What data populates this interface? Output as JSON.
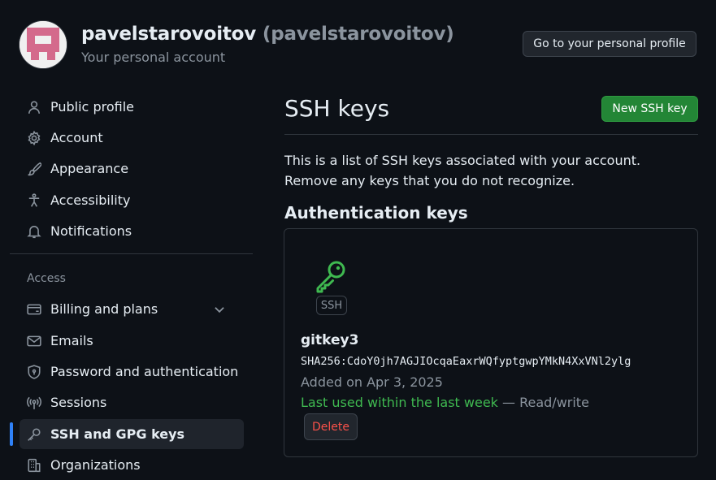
{
  "header": {
    "username": "pavelstarovoitov",
    "handle": "(pavelstarovoitov)",
    "subtitle": "Your personal account",
    "profile_button": "Go to your personal profile"
  },
  "sidebar": {
    "items": [
      {
        "label": "Public profile",
        "icon": "person-icon"
      },
      {
        "label": "Account",
        "icon": "gear-icon"
      },
      {
        "label": "Appearance",
        "icon": "paintbrush-icon"
      },
      {
        "label": "Accessibility",
        "icon": "accessibility-icon"
      },
      {
        "label": "Notifications",
        "icon": "bell-icon"
      }
    ],
    "section_label": "Access",
    "access_items": [
      {
        "label": "Billing and plans",
        "icon": "credit-card-icon"
      },
      {
        "label": "Emails",
        "icon": "mail-icon"
      },
      {
        "label": "Password and authentication",
        "icon": "shield-lock-icon"
      },
      {
        "label": "Sessions",
        "icon": "broadcast-icon"
      },
      {
        "label": "SSH and GPG keys",
        "icon": "key-icon"
      },
      {
        "label": "Organizations",
        "icon": "organization-icon"
      }
    ]
  },
  "main": {
    "title": "SSH keys",
    "new_button": "New SSH key",
    "description": "This is a list of SSH keys associated with your account. Remove any keys that you do not recognize.",
    "section_title": "Authentication keys",
    "key": {
      "badge": "SSH",
      "name": "gitkey3",
      "fingerprint": "SHA256:CdoY0jh7AGJIOcqaEaxrWQfyptgwpYMkN4XxVNl2ylg",
      "added": "Added on Apr 3, 2025",
      "last_used": "Last used within the last week",
      "access": " — Read/write",
      "delete_button": "Delete"
    }
  },
  "colors": {
    "background": "#0d1117",
    "accent_green": "#238636",
    "text_green": "#3fb950",
    "danger": "#f85149",
    "active_bar": "#2f81f7"
  }
}
